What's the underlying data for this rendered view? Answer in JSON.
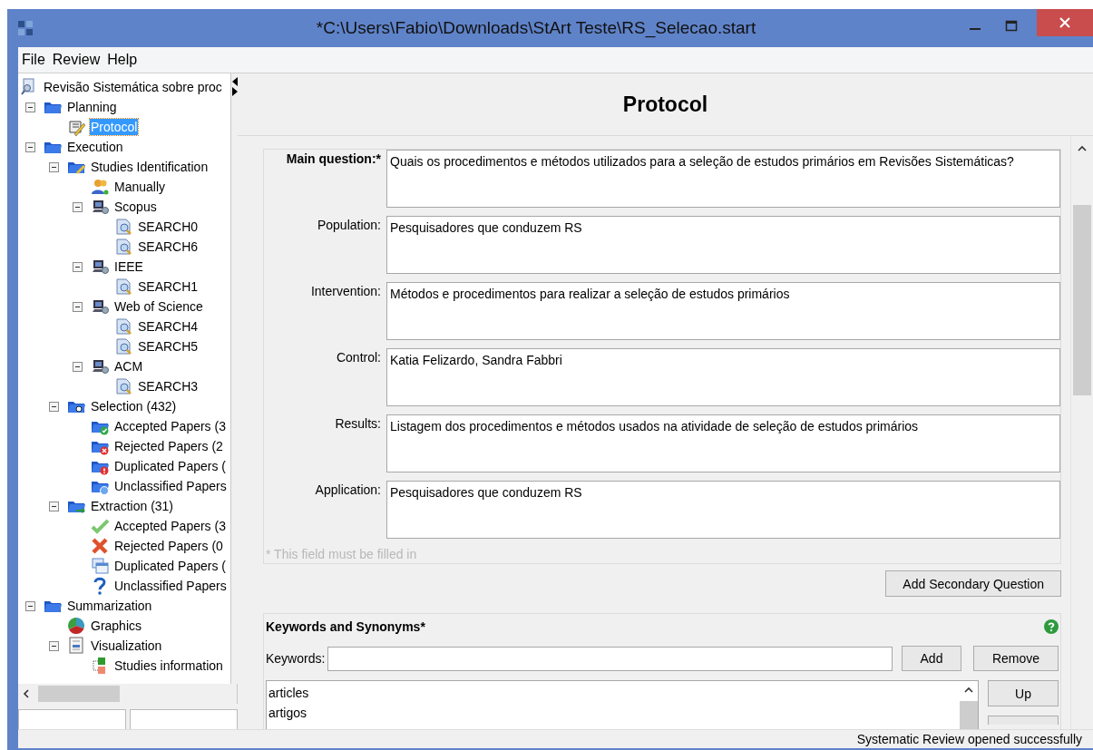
{
  "window": {
    "title": "*C:\\Users\\Fabio\\Downloads\\StArt Teste\\RS_Selecao.start"
  },
  "menu": [
    "File",
    "Review",
    "Help"
  ],
  "tree": {
    "label": "Revisão Sistemática sobre proc",
    "kind": "review",
    "selected": false,
    "children": [
      {
        "label": "Planning",
        "kind": "folder",
        "selected": false,
        "expanded": true,
        "children": [
          {
            "label": "Protocol",
            "kind": "protocol",
            "selected": true
          }
        ]
      },
      {
        "label": "Execution",
        "kind": "folder",
        "selected": false,
        "expanded": true,
        "children": [
          {
            "label": "Studies Identification",
            "kind": "folder-edit",
            "selected": false,
            "expanded": true,
            "children": [
              {
                "label": "Manually",
                "kind": "people",
                "selected": false
              },
              {
                "label": "Scopus",
                "kind": "source",
                "selected": false,
                "expanded": true,
                "children": [
                  {
                    "label": "SEARCH0",
                    "kind": "query",
                    "selected": false
                  },
                  {
                    "label": "SEARCH6",
                    "kind": "query",
                    "selected": false
                  }
                ]
              },
              {
                "label": "IEEE",
                "kind": "source",
                "selected": false,
                "expanded": true,
                "children": [
                  {
                    "label": "SEARCH1",
                    "kind": "query",
                    "selected": false
                  }
                ]
              },
              {
                "label": "Web of Science",
                "kind": "source",
                "selected": false,
                "expanded": true,
                "children": [
                  {
                    "label": "SEARCH4",
                    "kind": "query",
                    "selected": false
                  },
                  {
                    "label": "SEARCH5",
                    "kind": "query",
                    "selected": false
                  }
                ]
              },
              {
                "label": "ACM",
                "kind": "source",
                "selected": false,
                "expanded": true,
                "children": [
                  {
                    "label": "SEARCH3",
                    "kind": "query",
                    "selected": false
                  }
                ]
              }
            ]
          },
          {
            "label": "Selection (432)",
            "kind": "folder-search",
            "selected": false,
            "expanded": true,
            "children": [
              {
                "label": "Accepted Papers (3",
                "kind": "folder-accepted",
                "selected": false
              },
              {
                "label": "Rejected Papers (2",
                "kind": "folder-rejected",
                "selected": false
              },
              {
                "label": "Duplicated Papers (",
                "kind": "folder-duplicated",
                "selected": false
              },
              {
                "label": "Unclassified Papers",
                "kind": "folder-unclassified",
                "selected": false
              }
            ]
          },
          {
            "label": "Extraction (31)",
            "kind": "folder-extract",
            "selected": false,
            "expanded": true,
            "children": [
              {
                "label": "Accepted Papers (3",
                "kind": "accepted",
                "selected": false
              },
              {
                "label": "Rejected Papers (0",
                "kind": "rejected",
                "selected": false
              },
              {
                "label": "Duplicated Papers (",
                "kind": "duplicated",
                "selected": false
              },
              {
                "label": "Unclassified Papers",
                "kind": "unclassified",
                "selected": false
              }
            ]
          }
        ]
      },
      {
        "label": "Summarization",
        "kind": "folder",
        "selected": false,
        "expanded": true,
        "children": [
          {
            "label": "Graphics",
            "kind": "chart",
            "selected": false
          },
          {
            "label": "Visualization",
            "kind": "view",
            "selected": false,
            "expanded": true,
            "children": [
              {
                "label": "Studies information",
                "kind": "info",
                "selected": false
              }
            ]
          }
        ]
      }
    ]
  },
  "protocol": {
    "heading": "Protocol",
    "fields": [
      {
        "label": "Main question:*",
        "required": true,
        "value": "Quais os procedimentos e métodos utilizados para a seleção de estudos primários em Revisões Sistemáticas?"
      },
      {
        "label": "Population:",
        "required": false,
        "value": "Pesquisadores que conduzem RS"
      },
      {
        "label": "Intervention:",
        "required": false,
        "value": "Métodos e procedimentos para realizar a seleção de estudos primários"
      },
      {
        "label": "Control:",
        "required": false,
        "value": "Katia Felizardo, Sandra Fabbri"
      },
      {
        "label": "Results:",
        "required": false,
        "value": "Listagem dos procedimentos e métodos usados na atividade de seleção de estudos primários"
      },
      {
        "label": "Application:",
        "required": false,
        "value": "Pesquisadores que conduzem RS"
      }
    ],
    "hint": "* This field must be filled in",
    "secondary_button": "Add Secondary Question"
  },
  "keywords": {
    "title": "Keywords and Synonyms*",
    "field_label": "Keywords:",
    "buttons": [
      "Add",
      "Remove"
    ],
    "items": [
      "articles",
      "artigos"
    ],
    "side_buttons": [
      "Up"
    ]
  },
  "status": "Systematic Review opened successfully"
}
